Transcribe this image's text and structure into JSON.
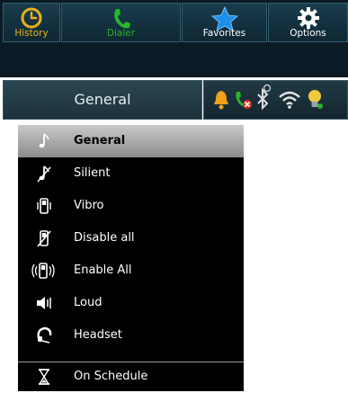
{
  "tabs": [
    {
      "label": "History",
      "icon": "clock-icon",
      "label_color": "#e7b21a"
    },
    {
      "label": "Dialer",
      "icon": "phone-icon",
      "label_color": "#27b52a"
    },
    {
      "label": "Favorites",
      "icon": "star-icon",
      "label_color": "#ffffff"
    },
    {
      "label": "Options",
      "icon": "gear-icon",
      "label_color": "#ffffff"
    }
  ],
  "profile": {
    "label": "General"
  },
  "status_icons": [
    "bell-icon",
    "missed-call-icon",
    "bluetooth-icon",
    "wifi-icon",
    "bulb-icon"
  ],
  "menu": {
    "items": [
      {
        "label": "General",
        "icon": "music-note-icon",
        "selected": true
      },
      {
        "label": "Silient",
        "icon": "muted-note-icon",
        "selected": false
      },
      {
        "label": "Vibro",
        "icon": "vibrate-phone-icon",
        "selected": false
      },
      {
        "label": "Disable all",
        "icon": "phone-off-icon",
        "selected": false
      },
      {
        "label": "Enable All",
        "icon": "phone-waves-icon",
        "selected": false
      },
      {
        "label": "Loud",
        "icon": "speaker-icon",
        "selected": false
      },
      {
        "label": "Headset",
        "icon": "headset-icon",
        "selected": false
      },
      {
        "label": "On Schedule",
        "icon": "hourglass-icon",
        "selected": false
      }
    ]
  },
  "colors": {
    "history_accent": "#e7b21a",
    "dialer_accent": "#27b52a",
    "favorites_accent": "#1e8fe6",
    "menu_background": "#000000",
    "selected_item": "#b4b4b4"
  }
}
